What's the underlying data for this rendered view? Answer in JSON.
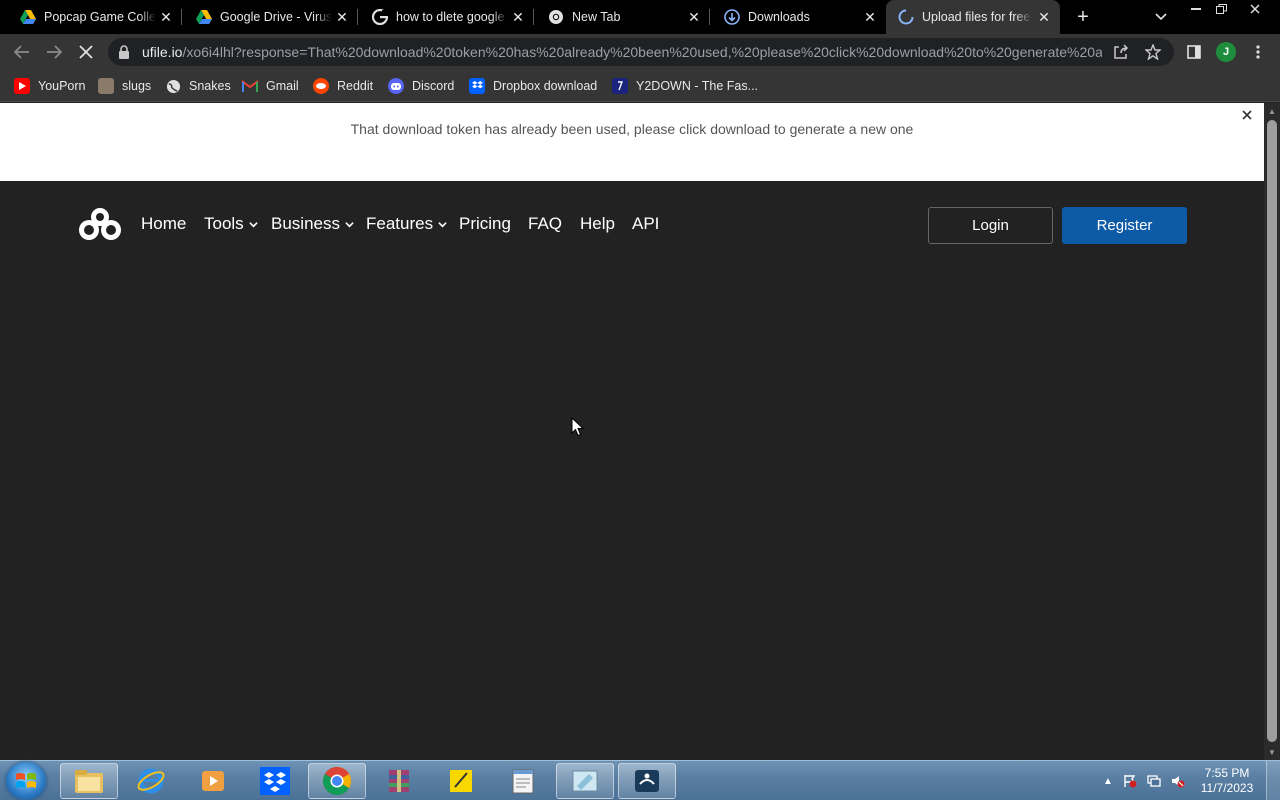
{
  "browser": {
    "tabs": [
      {
        "title": "Popcap Game Collection",
        "icon": "google-drive-icon"
      },
      {
        "title": "Google Drive - Virus",
        "icon": "google-drive-icon"
      },
      {
        "title": "how to dlete google",
        "icon": "google-icon"
      },
      {
        "title": "New Tab",
        "icon": "chrome-icon"
      },
      {
        "title": "Downloads",
        "icon": "downloads-icon"
      },
      {
        "title": "Upload files for free",
        "icon": "loading-spinner-icon",
        "active": true
      }
    ],
    "address": {
      "host": "ufile.io",
      "path": "/xo6i4lhl?response=That%20download%20token%20has%20already%20been%20used,%20please%20click%20download%20to%20generate%20a%..."
    },
    "profile_initial": "J",
    "bookmarks": [
      {
        "label": "YouPorn",
        "icon": "youtube-style-icon"
      },
      {
        "label": "slugs",
        "icon": "slug-icon"
      },
      {
        "label": "Snakes",
        "icon": "globe-icon"
      },
      {
        "label": "Gmail",
        "icon": "gmail-icon"
      },
      {
        "label": "Reddit",
        "icon": "reddit-icon"
      },
      {
        "label": "Discord",
        "icon": "discord-icon"
      },
      {
        "label": "Dropbox download",
        "icon": "dropbox-icon"
      },
      {
        "label": "Y2DOWN - The Fas...",
        "icon": "y2down-icon"
      }
    ]
  },
  "page": {
    "notice": "That download token has already been used, please click download to generate a new one",
    "nav": {
      "home": "Home",
      "tools": "Tools",
      "business": "Business",
      "features": "Features",
      "pricing": "Pricing",
      "faq": "FAQ",
      "help": "Help",
      "api": "API"
    },
    "login": "Login",
    "register": "Register",
    "colors": {
      "register_bg": "#0d5aa7",
      "page_bg": "#222222",
      "notice_bg": "#ffffff"
    }
  },
  "taskbar": {
    "apps": [
      "windows-explorer-icon",
      "internet-explorer-icon",
      "media-player-icon",
      "dropbox-icon",
      "chrome-icon",
      "winrar-icon",
      "sticky-notes-icon",
      "notepad-icon",
      "paint-icon",
      "game-icon"
    ],
    "time": "7:55 PM",
    "date": "11/7/2023"
  }
}
